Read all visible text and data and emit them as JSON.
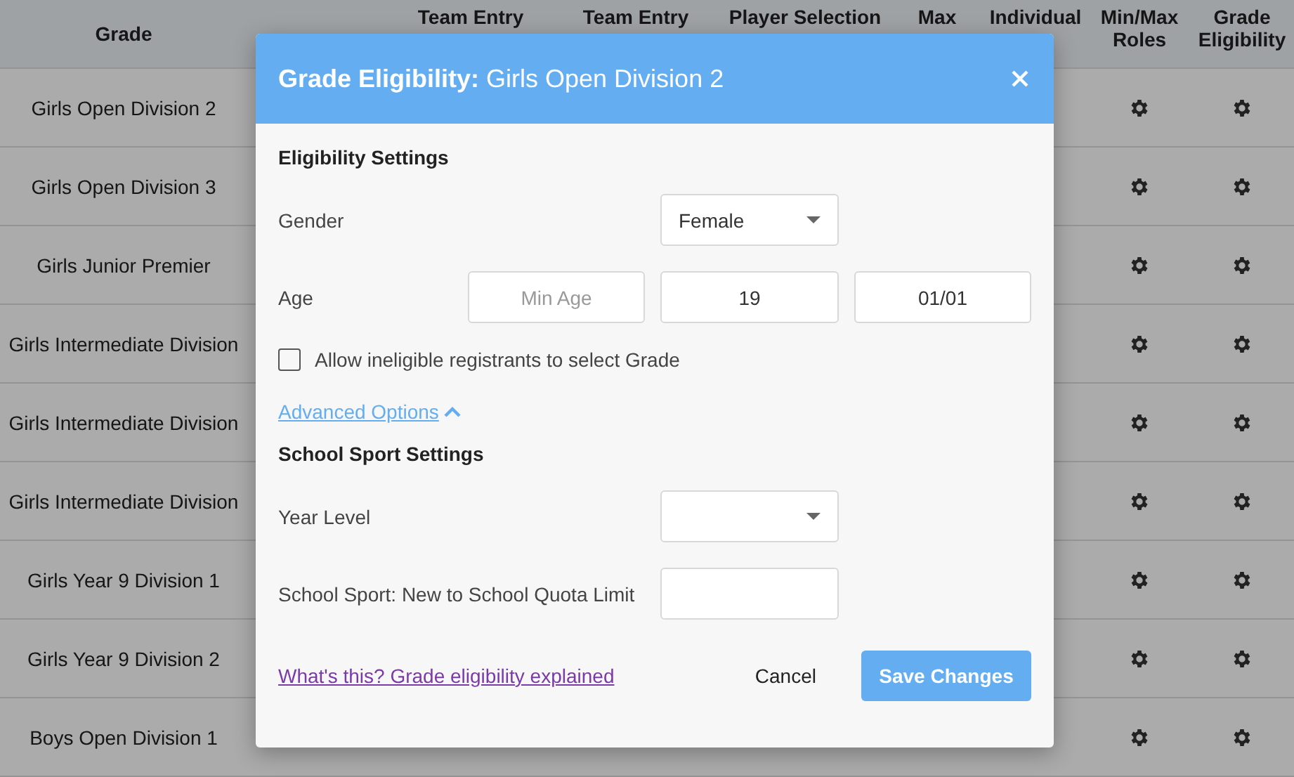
{
  "table": {
    "columns": [
      "Grade",
      "",
      "Team Entry",
      "Team Entry",
      "Player Selection",
      "Max",
      "Individual",
      "Min/Max Roles",
      "Grade Eligibility"
    ],
    "rows": [
      {
        "grade": "Girls Open Division 2"
      },
      {
        "grade": "Girls Open Division 3"
      },
      {
        "grade": "Girls Junior Premier"
      },
      {
        "grade": "Girls Intermediate Division"
      },
      {
        "grade": "Girls Intermediate Division"
      },
      {
        "grade": "Girls Intermediate Division"
      },
      {
        "grade": "Girls Year 9 Division 1"
      },
      {
        "grade": "Girls Year 9 Division 2"
      },
      {
        "grade": "Boys Open Division 1"
      }
    ]
  },
  "dialog": {
    "title_bold": "Grade Eligibility:",
    "title": "Girls Open Division 2",
    "section_1": "Eligibility Settings",
    "gender": {
      "label": "Gender",
      "value": "Female"
    },
    "age": {
      "label": "Age",
      "min_placeholder": "Min Age",
      "max_value": "19",
      "date_value": "01/01"
    },
    "allow_ineligible": {
      "label": "Allow ineligible registrants to select Grade",
      "checked": false
    },
    "advanced": {
      "label": "Advanced Options",
      "expanded": true
    },
    "section_2": "School Sport Settings",
    "year_level": {
      "label": "Year Level"
    },
    "quota": {
      "label": "School Sport: New to School Quota Limit"
    },
    "help_link": "What's this? Grade eligibility explained",
    "cancel": "Cancel",
    "save": "Save Changes"
  }
}
